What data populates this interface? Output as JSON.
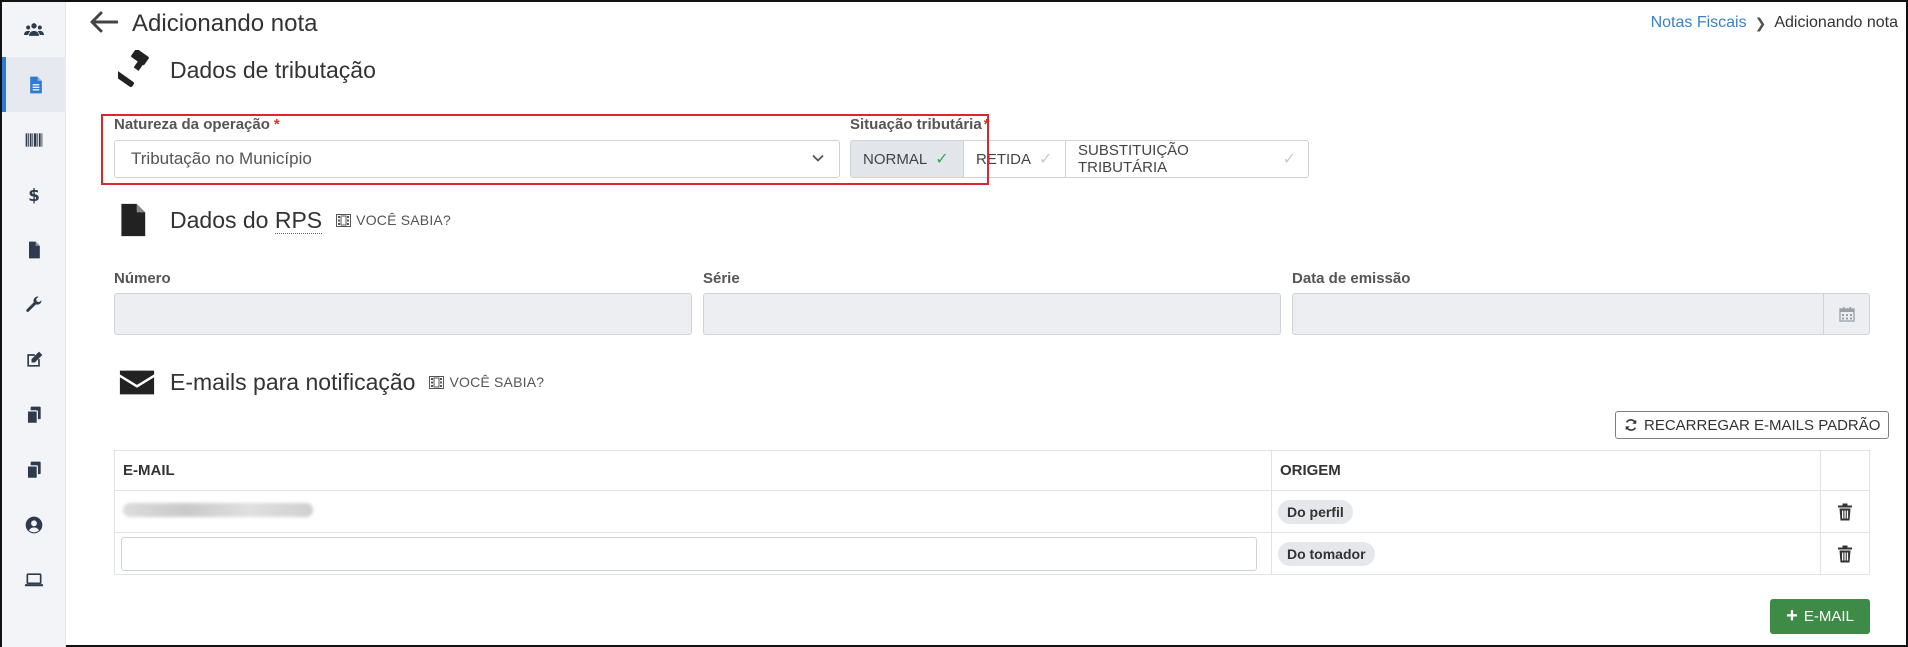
{
  "header": {
    "title": "Adicionando nota",
    "breadcrumb": {
      "parent": "Notas Fiscais",
      "current": "Adicionando nota"
    }
  },
  "sidebar": {
    "items": [
      {
        "icon": "users-icon"
      },
      {
        "icon": "file-icon",
        "active": true
      },
      {
        "icon": "barcode-icon"
      },
      {
        "icon": "dollar-icon"
      },
      {
        "icon": "document-icon"
      },
      {
        "icon": "wrench-icon"
      },
      {
        "icon": "edit-icon"
      },
      {
        "icon": "copy-icon"
      },
      {
        "icon": "copy-icon"
      },
      {
        "icon": "user-circle-icon"
      },
      {
        "icon": "laptop-icon"
      }
    ]
  },
  "tributacao": {
    "title": "Dados de tributação",
    "natureza_label": "Natureza da operação",
    "natureza_value": "Tributação no Município",
    "situacao_label": "Situação tributária",
    "required_mark": "*",
    "situacao_options": [
      {
        "label": "NORMAL",
        "selected": true
      },
      {
        "label": "RETIDA",
        "selected": false
      },
      {
        "label": "SUBSTITUIÇÃO TRIBUTÁRIA",
        "selected": false
      }
    ]
  },
  "rps": {
    "title_prefix": "Dados do ",
    "title_abbr": "RPS",
    "voce_sabia": "VOCÊ SABIA?",
    "numero_label": "Número",
    "serie_label": "Série",
    "data_label": "Data de emissão"
  },
  "emails": {
    "title": "E-mails para notificação",
    "voce_sabia": "VOCÊ SABIA?",
    "reload_button": "RECARREGAR E-MAILS PADRÃO",
    "col_email": "E-MAIL",
    "col_origem": "ORIGEM",
    "rows": [
      {
        "origem": "Do perfil"
      },
      {
        "origem": "Do tomador"
      }
    ],
    "add_button": "E-MAIL",
    "add_symbol": "+"
  },
  "colors": {
    "accent": "#2f7bd1",
    "success": "#3d8b46",
    "required": "#d0312d",
    "highlight": "#d9262f"
  }
}
